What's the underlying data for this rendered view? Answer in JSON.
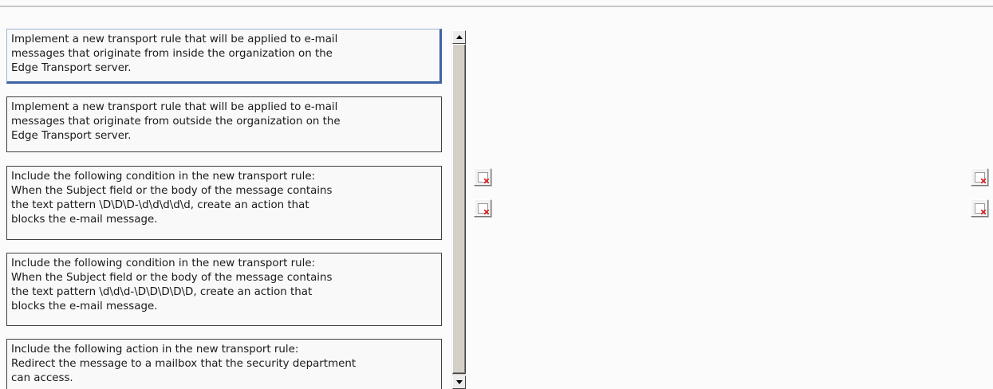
{
  "options": [
    {
      "text": "Implement a new transport rule that will be applied to e-mail\nmessages that originate from inside the organization on the\nEdge Transport server.",
      "selected": true
    },
    {
      "text": "Implement a new transport rule that will be applied to e-mail\nmessages that originate from outside the organization on the\nEdge Transport server.",
      "selected": false
    },
    {
      "text": "Include the following condition in the new transport rule:\nWhen the Subject field or the body of the message contains\nthe text pattern \\D\\D\\D-\\d\\d\\d\\d\\d, create an action that\nblocks the e-mail message.",
      "selected": false
    },
    {
      "text": "Include the following condition in the new transport rule:\nWhen the Subject field or the body of the message contains\nthe text pattern \\d\\d\\d-\\D\\D\\D\\D\\D, create an action that\nblocks the e-mail message.",
      "selected": false
    },
    {
      "text": "Include the following action in the new transport rule:\nRedirect the message to a mailbox that the security department\ncan access.",
      "selected": false
    }
  ],
  "controls": {
    "left_buttons": [
      "broken-image-icon",
      "broken-image-icon"
    ],
    "right_buttons": [
      "broken-image-icon",
      "broken-image-icon"
    ]
  }
}
